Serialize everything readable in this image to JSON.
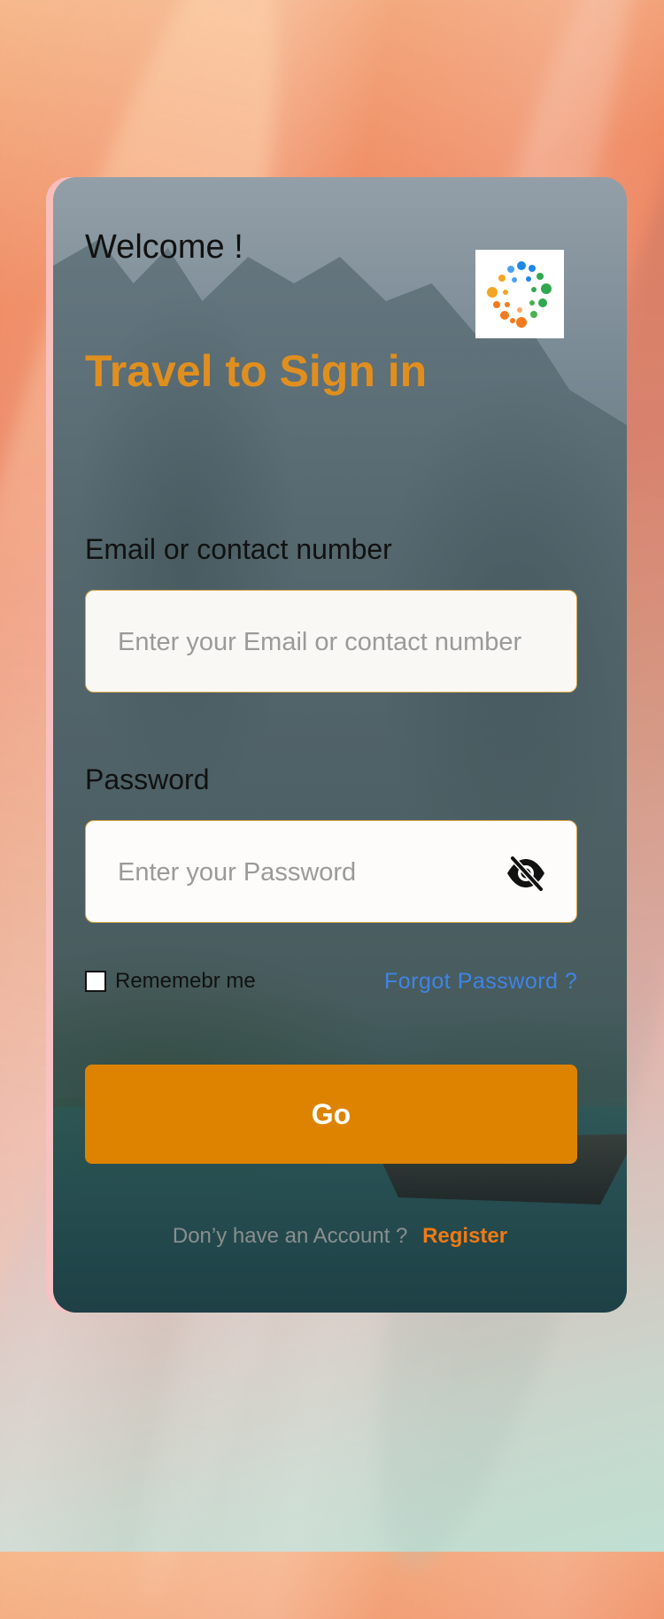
{
  "welcome": "Welcome !",
  "headline": "Travel to Sign in",
  "email": {
    "label": "Email or contact number",
    "placeholder": "Enter your Email or contact number",
    "value": ""
  },
  "password": {
    "label": "Password",
    "placeholder": "Enter your Password",
    "value": "",
    "toggle_icon": "eye-slash-icon"
  },
  "remember": {
    "label": "Rememebr me",
    "checked": false
  },
  "forgot_password": "Forgot Password ?",
  "submit_label": "Go",
  "register": {
    "prompt": "Don’y have an Account ?",
    "link": "Register"
  },
  "colors": {
    "accent": "#dd8300",
    "headline": "#e08f1f",
    "link": "#3f84e6",
    "register": "#f07a12"
  },
  "logo_icon": "dotted-circle-logo-icon"
}
